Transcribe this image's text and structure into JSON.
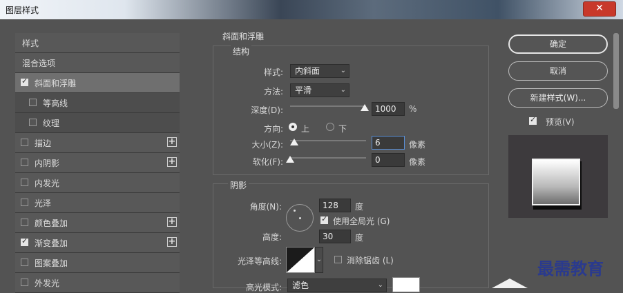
{
  "window": {
    "title": "图层样式",
    "close_glyph": "✕"
  },
  "sidebar": {
    "items": [
      {
        "label": "样式",
        "checkbox": null,
        "plus": false,
        "active": false
      },
      {
        "label": "混合选项",
        "checkbox": null,
        "plus": false,
        "active": false
      },
      {
        "label": "斜面和浮雕",
        "checkbox": true,
        "plus": false,
        "active": true
      },
      {
        "label": "等高线",
        "checkbox": false,
        "plus": false,
        "sub": true
      },
      {
        "label": "纹理",
        "checkbox": false,
        "plus": false,
        "sub": true
      },
      {
        "label": "描边",
        "checkbox": false,
        "plus": true
      },
      {
        "label": "内阴影",
        "checkbox": false,
        "plus": true
      },
      {
        "label": "内发光",
        "checkbox": false,
        "plus": false
      },
      {
        "label": "光泽",
        "checkbox": false,
        "plus": false
      },
      {
        "label": "颜色叠加",
        "checkbox": false,
        "plus": true
      },
      {
        "label": "渐变叠加",
        "checkbox": true,
        "plus": true
      },
      {
        "label": "图案叠加",
        "checkbox": false,
        "plus": false
      },
      {
        "label": "外发光",
        "checkbox": false,
        "plus": false
      }
    ]
  },
  "bevel": {
    "section_title": "斜面和浮雕",
    "structure_title": "结构",
    "style_label": "样式:",
    "style_value": "内斜面",
    "technique_label": "方法:",
    "technique_value": "平滑",
    "depth_label": "深度(D):",
    "depth_value": "1000",
    "depth_unit": "%",
    "direction_label": "方向:",
    "direction_up": "上",
    "direction_down": "下",
    "size_label": "大小(Z):",
    "size_value": "6",
    "size_unit": "像素",
    "soften_label": "软化(F):",
    "soften_value": "0",
    "soften_unit": "像素"
  },
  "shading": {
    "title": "阴影",
    "angle_label": "角度(N):",
    "angle_value": "128",
    "angle_unit": "度",
    "global_light_label": "使用全局光 (G)",
    "global_light_checked": true,
    "altitude_label": "高度:",
    "altitude_value": "30",
    "altitude_unit": "度",
    "gloss_label": "光泽等高线:",
    "anti_alias_label": "消除锯齿 (L)",
    "highlight_label": "高光模式:",
    "highlight_value": "滤色"
  },
  "buttons": {
    "ok": "确定",
    "cancel": "取消",
    "new_style": "新建样式(W)...",
    "preview_label": "预览(V)",
    "preview_checked": true
  },
  "watermark": "最需教育"
}
